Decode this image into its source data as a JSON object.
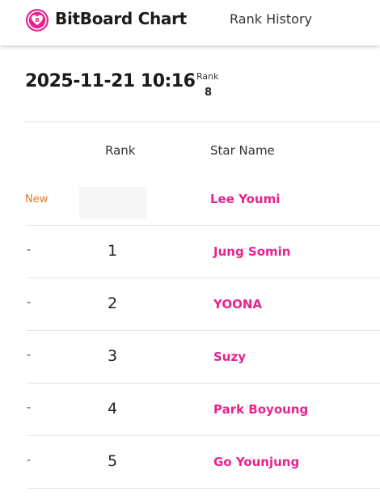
{
  "header": {
    "brand": "BitBoard Chart",
    "nav_link": "Rank History"
  },
  "summary": {
    "timestamp": "2025-11-21 10:16",
    "rank_label": "Rank",
    "rank_value": "8"
  },
  "table": {
    "columns": {
      "rank": "Rank",
      "name": "Star Name"
    },
    "rows": [
      {
        "change": "New",
        "rank": "",
        "name": "Lee Youmi"
      },
      {
        "change": "-",
        "rank": "1",
        "name": "Jung Somin"
      },
      {
        "change": "-",
        "rank": "2",
        "name": "YOONA"
      },
      {
        "change": "-",
        "rank": "3",
        "name": "Suzy"
      },
      {
        "change": "-",
        "rank": "4",
        "name": "Park Boyoung"
      },
      {
        "change": "-",
        "rank": "5",
        "name": "Go Younjung"
      }
    ]
  },
  "colors": {
    "accent": "#e8238c",
    "new_badge": "#e07a2a",
    "text": "#222222"
  },
  "icons": {
    "logo": "heart-b-logo-icon"
  }
}
